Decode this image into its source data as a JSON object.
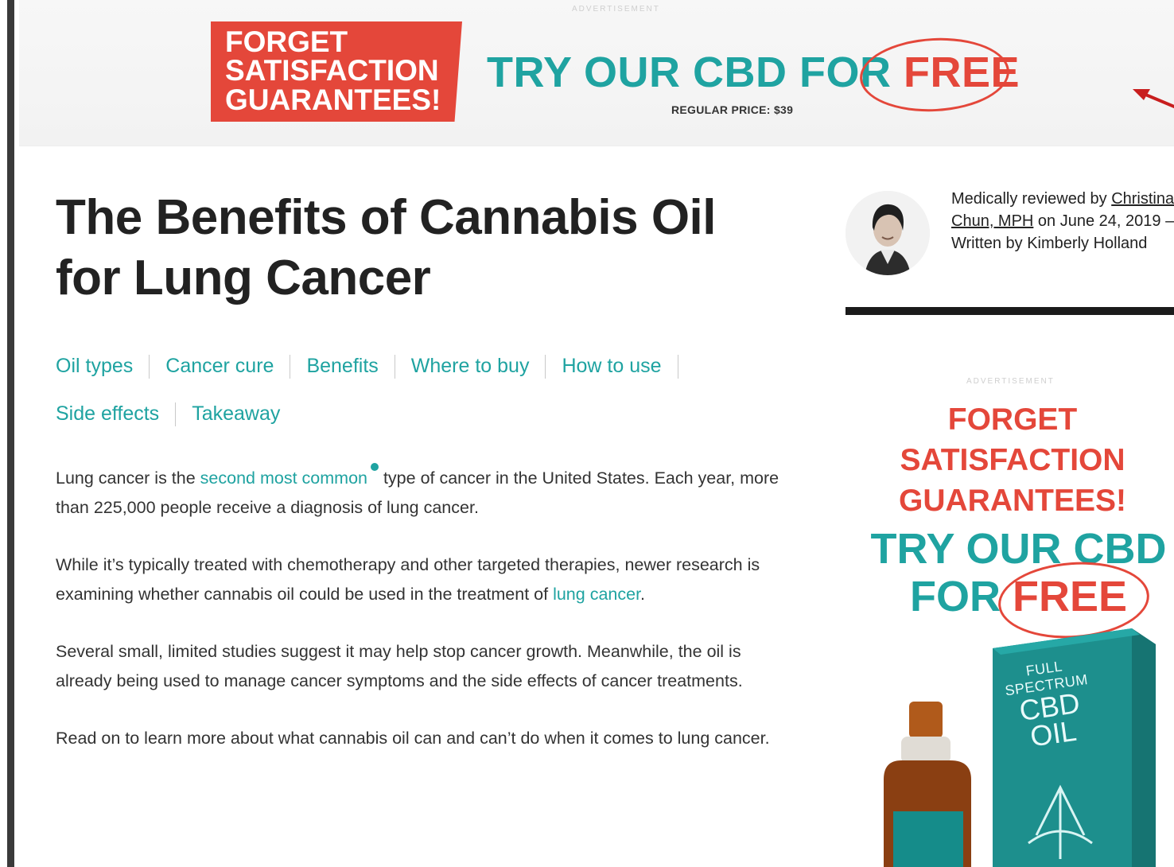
{
  "colors": {
    "teal": "#1fa3a1",
    "red": "#e4473a",
    "ink": "#222222"
  },
  "top_ad": {
    "label": "ADVERTISEMENT",
    "box_lines": [
      "FORGET",
      "SATISFACTION",
      "GUARANTEES!"
    ],
    "headline_prefix": "TRY OUR CBD FOR ",
    "headline_free": "FREE",
    "regular_price": "REGULAR PRICE: $39"
  },
  "article": {
    "title": "The Benefits of Cannabis Oil for Lung Cancer",
    "toc": [
      "Oil types",
      "Cancer cure",
      "Benefits",
      "Where to buy",
      "How to use",
      "Side effects",
      "Takeaway"
    ],
    "p1_before": "Lung cancer is the ",
    "p1_link": "second most common",
    "p1_after": " type of cancer in the United States. Each year, more than 225,000 people receive a diagnosis of lung cancer.",
    "p2_before": "While it’s typically treated with chemotherapy and other targeted therapies, newer research is examining whether cannabis oil could be used in the treatment of ",
    "p2_link": "lung cancer",
    "p2_after": ".",
    "p3": "Several small, limited studies suggest it may help stop cancer growth. Meanwhile, the oil is already being used to manage cancer symptoms and the side effects of cancer treatments.",
    "p4": "Read on to learn more about what cannabis oil can and can’t do when it comes to lung cancer."
  },
  "reviewer": {
    "prefix": "Medically reviewed by ",
    "name": "Christina Chun, MPH",
    "mid": " on June 24, 2019 — Written by Kimberly Holland"
  },
  "side_ad": {
    "label": "ADVERTISEMENT",
    "lines": [
      "FORGET",
      "SATISFACTION",
      "GUARANTEES!"
    ],
    "try_line1": "TRY OUR CBD",
    "try_for": "FOR ",
    "try_free": "FREE",
    "product_line1": "FULL SPECTRUM",
    "product_line2": "CBD OIL"
  }
}
